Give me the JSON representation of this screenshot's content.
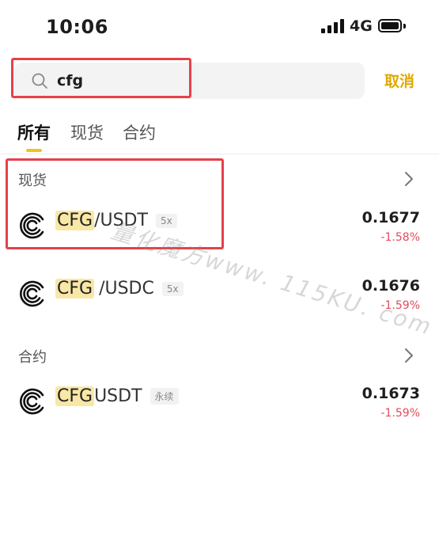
{
  "status_bar": {
    "time": "10:06",
    "network": "4G"
  },
  "search": {
    "value": "cfg",
    "placeholder": ""
  },
  "cancel_label": "取消",
  "tabs": [
    {
      "label": "所有",
      "active": true
    },
    {
      "label": "现货",
      "active": false
    },
    {
      "label": "合约",
      "active": false
    }
  ],
  "sections": {
    "spot": {
      "title": "现货",
      "rows": [
        {
          "base": "CFG",
          "quote": "/USDT",
          "badge": "5x",
          "price": "0.1677",
          "change": "-1.58%"
        },
        {
          "base": "CFG",
          "quote": "/USDC",
          "badge": "5x",
          "price": "0.1676",
          "change": "-1.59%"
        }
      ]
    },
    "futures": {
      "title": "合约",
      "rows": [
        {
          "base": "CFG",
          "quote": "USDT",
          "badge": "永续",
          "price": "0.1673",
          "change": "-1.59%"
        }
      ]
    }
  },
  "watermark": "量化魔方www. 115KU. com",
  "colors": {
    "accent": "#e0a800",
    "negative": "#e24a5a",
    "highlight_box": "#e6404a",
    "match_bg": "#f9e7a6"
  }
}
